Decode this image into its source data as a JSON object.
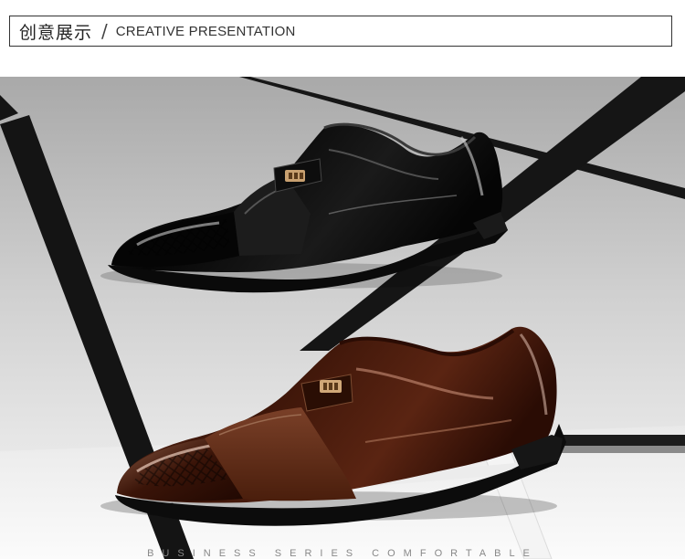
{
  "header": {
    "title_cn": "创意展示",
    "separator": "/",
    "title_en": "CREATIVE PRESENTATION"
  },
  "photo": {
    "subject": "two patent leather slip-on dress shoes on black and white geometric frames",
    "shoes": [
      {
        "color_name": "black",
        "color": "#0c0c0c"
      },
      {
        "color_name": "brown",
        "color": "#4a1c0c"
      }
    ],
    "background": "#c8c8c8"
  },
  "footer": {
    "caption": "BUSINESS SERIES COMFORTABLE"
  }
}
